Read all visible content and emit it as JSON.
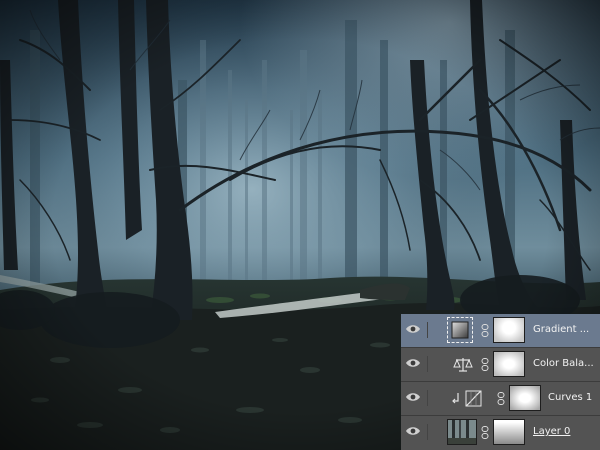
{
  "layers_panel": {
    "layers": [
      {
        "name": "Gradient ...",
        "type": "gradient-fill",
        "selected": true,
        "visible": true
      },
      {
        "name": "Color Bala...",
        "type": "color-balance",
        "selected": false,
        "visible": true
      },
      {
        "name": "Curves 1",
        "type": "curves",
        "selected": false,
        "visible": true,
        "clipped": true
      },
      {
        "name": "Layer 0",
        "type": "pixel",
        "selected": false,
        "visible": true
      }
    ]
  },
  "colors": {
    "panel_bg": "#535353",
    "selected_row": "#6b7a8f",
    "fog": "#7f99ab",
    "forest_floor": "#1d2320"
  }
}
